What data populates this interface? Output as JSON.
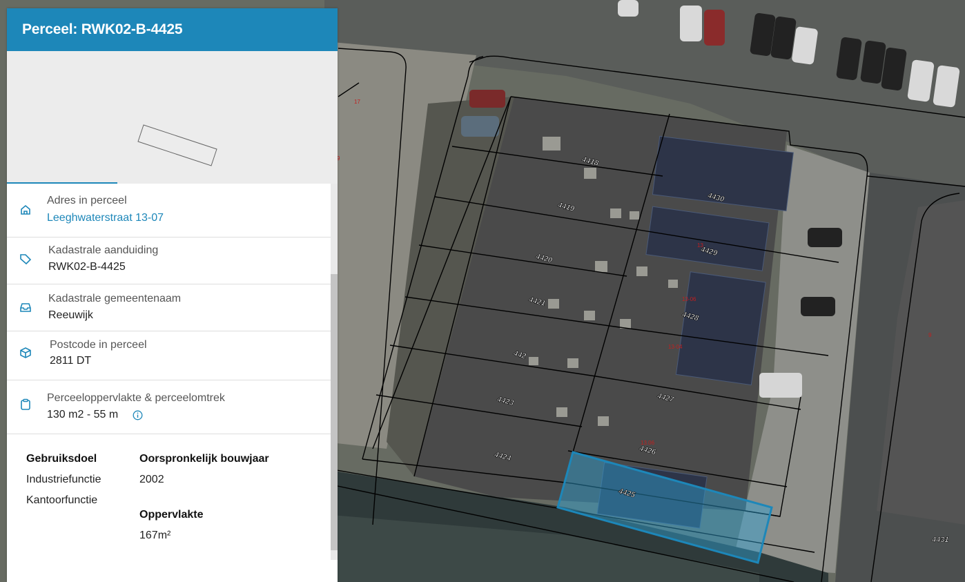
{
  "panel": {
    "title": "Perceel: RWK02-B-4425",
    "rows": [
      {
        "label": "Adres in perceel",
        "value": "Leeghwaterstraat 13-07",
        "icon": "home-icon"
      },
      {
        "label": "Kadastrale aanduiding",
        "value": "RWK02-B-4425",
        "icon": "tag-icon"
      },
      {
        "label": "Kadastrale gemeentenaam",
        "value": "Reeuwijk",
        "icon": "inbox-icon"
      },
      {
        "label": "Postcode in perceel",
        "value": "2811 DT",
        "icon": "package-icon"
      },
      {
        "label": "Perceeloppervlakte & perceelomtrek",
        "value": "130 m2 - 55 m",
        "icon": "clipboard-icon"
      }
    ],
    "details": {
      "gebruiksdoel_label": "Gebruiksdoel",
      "gebruiksdoel_values": [
        "Industriefunctie",
        "Kantoorfunctie"
      ],
      "bouwjaar_label": "Oorspronkelijk bouwjaar",
      "bouwjaar_value": "2002",
      "oppervlakte_label": "Oppervlakte",
      "oppervlakte_value": "167m²"
    }
  },
  "map": {
    "parcel_labels": [
      "4418",
      "4419",
      "4420",
      "4421",
      "442",
      "4423",
      "4424",
      "4425",
      "4426",
      "4427",
      "4428",
      "4429",
      "4430",
      "4431"
    ],
    "house_numbers": [
      "17",
      "9",
      "13",
      "13-06",
      "13-04",
      "13.06",
      "9"
    ],
    "selection_color": "#1d87b9"
  }
}
